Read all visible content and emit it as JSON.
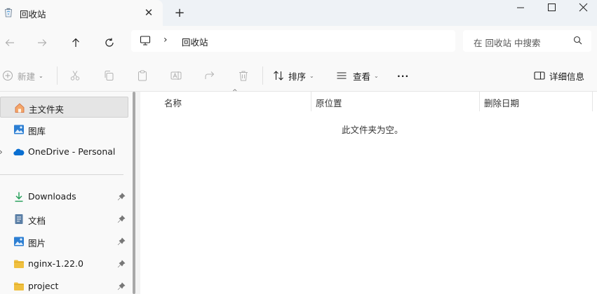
{
  "tab": {
    "title": "回收站"
  },
  "address": {
    "location": "回收站"
  },
  "search": {
    "placeholder": "在 回收站 中搜索"
  },
  "toolbar": {
    "new_label": "新建",
    "sort_label": "排序",
    "view_label": "查看",
    "more_label": "···",
    "details_label": "详细信息"
  },
  "sidebar": {
    "items": [
      {
        "label": "主文件夹"
      },
      {
        "label": "图库"
      },
      {
        "label": "OneDrive - Personal"
      },
      {
        "label": "Downloads"
      },
      {
        "label": "文档"
      },
      {
        "label": "图片"
      },
      {
        "label": "nginx-1.22.0"
      },
      {
        "label": "project"
      }
    ]
  },
  "columns": [
    "名称",
    "原位置",
    "删除日期"
  ],
  "empty_message": "此文件夹为空。",
  "colors": {
    "accent": "#0067c0",
    "folder": "#f0c040",
    "onedrive": "#0a6fd1"
  }
}
